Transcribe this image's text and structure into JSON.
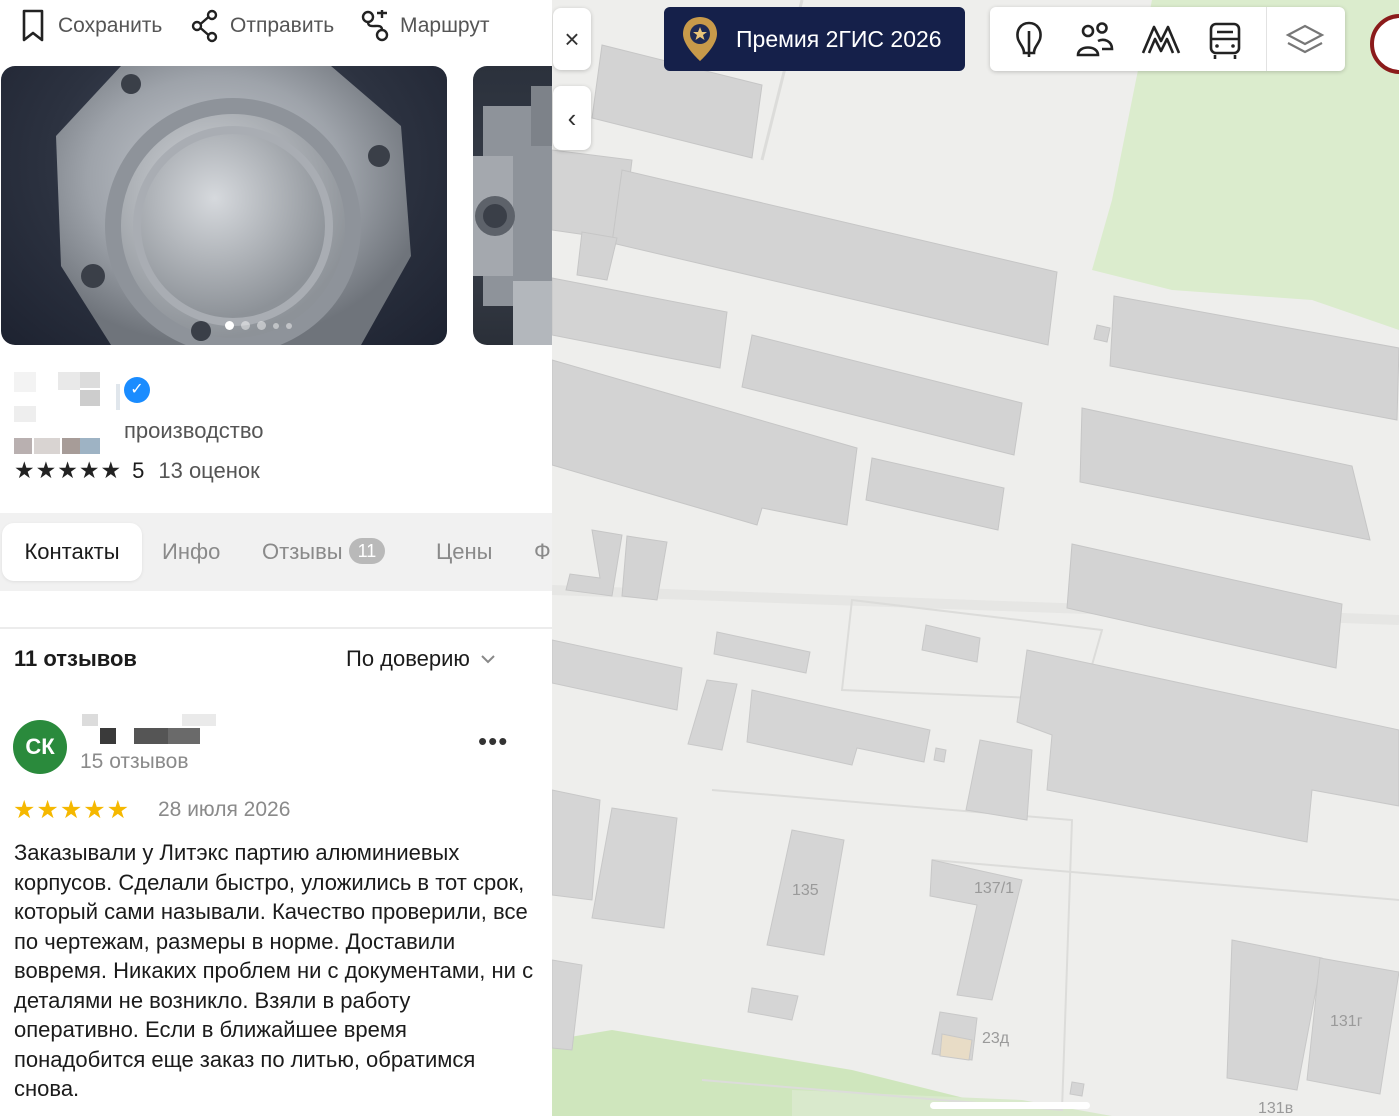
{
  "toolbar": {
    "save_label": "Сохранить",
    "share_label": "Отправить",
    "route_label": "Маршрут"
  },
  "photos": {
    "count": 5,
    "active_index": 0
  },
  "organization": {
    "category": "производство",
    "rating_stars": "★★★★★",
    "rating_value": "5",
    "rating_count": "13 оценок",
    "verified_icon": "checkmark-icon"
  },
  "tabs": [
    {
      "label": "Контакты",
      "active": true
    },
    {
      "label": "Инфо",
      "active": false
    },
    {
      "label": "Отзывы",
      "badge": "11",
      "active": false
    },
    {
      "label": "Цены",
      "active": false
    },
    {
      "label": "Ф",
      "active": false
    }
  ],
  "reviews": {
    "header": "11 отзывов",
    "sort_label": "По доверию",
    "items": [
      {
        "avatar_initials": "СК",
        "avatar_color": "#2a8a3c",
        "author_reviews": "15 отзывов",
        "stars": "★★★★★",
        "date": "28 июля 2026",
        "more": "•••",
        "text": "Заказывали у Литэкс партию алюминиевых корпусов. Сделали быстро, уложились в тот срок, который сами называли. Качество проверили, все по чертежам, размеры в норме. Доставили вовремя. Никаких проблем ни с документами, ни с деталями не возникло. Взяли в работу оперативно. Если в ближайшее время понадобится еще заказ по литью, обратимся снова."
      }
    ]
  },
  "map": {
    "close": "×",
    "collapse": "‹",
    "promo_label": "Премия 2ГИС 2026",
    "promo_color": "#15204a",
    "layers": [
      "landmarks-icon",
      "people-icon",
      "metro-icon",
      "transport-icon",
      "layers-icon"
    ],
    "house_numbers": [
      "135",
      "137/1",
      "23д",
      "131г",
      "131в"
    ]
  },
  "colors": {
    "accent_blue": "#1a8cff",
    "star_yellow": "#f5b800",
    "map_background": "#eeeeec",
    "map_green": "#dbeccd",
    "map_building": "#d5d5d5"
  }
}
